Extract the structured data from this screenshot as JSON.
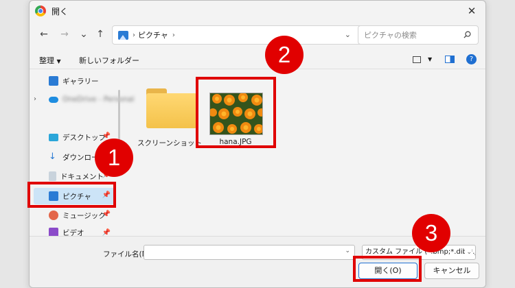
{
  "window": {
    "title": "開く"
  },
  "nav": {
    "path": "ピクチャ",
    "search_placeholder": "ピクチャの検索"
  },
  "toolbar": {
    "organize": "整理",
    "new_folder": "新しいフォルダー"
  },
  "sidebar": {
    "items": [
      {
        "label": "ギャラリー"
      },
      {
        "label": "OneDrive - Personal"
      },
      {
        "label": "デスクトップ"
      },
      {
        "label": "ダウンロード"
      },
      {
        "label": "ドキュメント"
      },
      {
        "label": "ピクチャ"
      },
      {
        "label": "ミュージック"
      },
      {
        "label": "ビデオ"
      }
    ]
  },
  "files": [
    {
      "name": "スクリーンショット",
      "type": "folder"
    },
    {
      "name": "hana.JPG",
      "type": "image"
    }
  ],
  "bottom": {
    "filename_label": "ファイル名(N):",
    "filename_value": "",
    "filetype": "カスタム ファイル (*.bmp;*.dib;*.jpg;*.jpeg;*.jpe;*.jfif;*.gif;*.tif;*.tiff;*.png;*.ico;*.heic;*.he",
    "open_label": "開く(O)",
    "cancel_label": "キャンセル"
  },
  "annotations": {
    "step1": "1",
    "step2": "2",
    "step3": "3"
  },
  "colors": {
    "selected": "#cce4f7",
    "annotation_red": "#e00000",
    "folder_yellow": "#f4c24a"
  }
}
